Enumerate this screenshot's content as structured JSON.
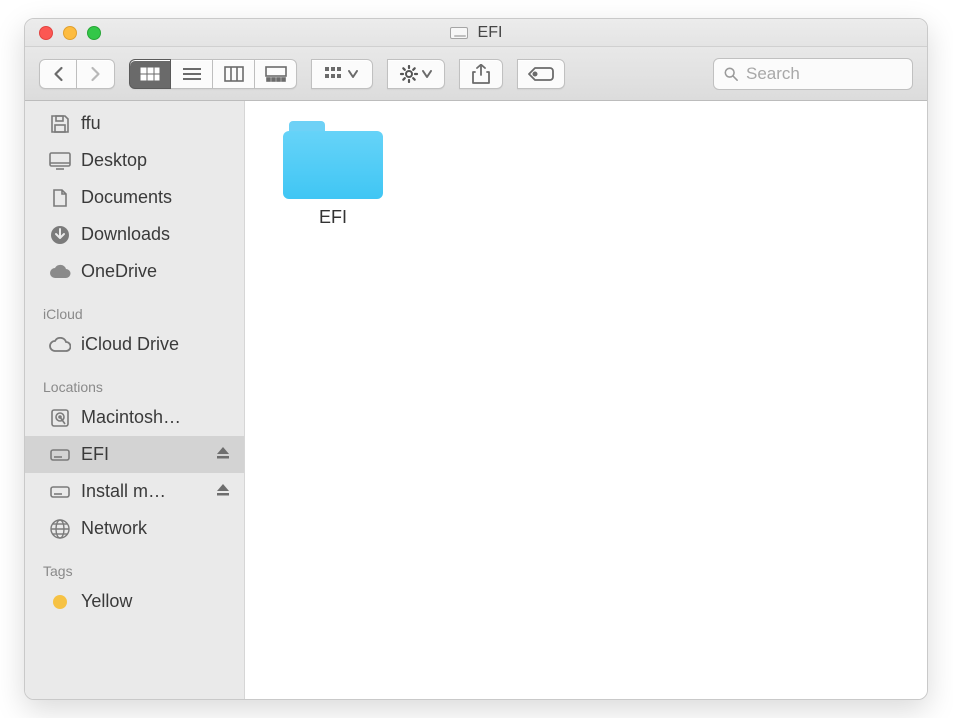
{
  "window": {
    "title": "EFI"
  },
  "search": {
    "placeholder": "Search"
  },
  "traffic": {
    "close": "#fc5753",
    "min": "#fdbc40",
    "max": "#33c748"
  },
  "sidebar": {
    "favorites": [
      {
        "label": "ffu",
        "icon": "floppy"
      },
      {
        "label": "Desktop",
        "icon": "desktop"
      },
      {
        "label": "Documents",
        "icon": "documents"
      },
      {
        "label": "Downloads",
        "icon": "downloads"
      },
      {
        "label": "OneDrive",
        "icon": "cloud-solid"
      }
    ],
    "icloud_heading": "iCloud",
    "icloud": [
      {
        "label": "iCloud Drive",
        "icon": "cloud"
      }
    ],
    "locations_heading": "Locations",
    "locations": [
      {
        "label": "Macintosh…",
        "icon": "hdd",
        "eject": false,
        "selected": false
      },
      {
        "label": "EFI",
        "icon": "drive",
        "eject": true,
        "selected": true
      },
      {
        "label": "Install m…",
        "icon": "drive",
        "eject": true,
        "selected": false
      },
      {
        "label": "Network",
        "icon": "network",
        "eject": false,
        "selected": false
      }
    ],
    "tags_heading": "Tags",
    "tags": [
      {
        "label": "Yellow",
        "color": "#f6c244"
      }
    ]
  },
  "content": {
    "items": [
      {
        "label": "EFI",
        "type": "folder"
      }
    ]
  }
}
